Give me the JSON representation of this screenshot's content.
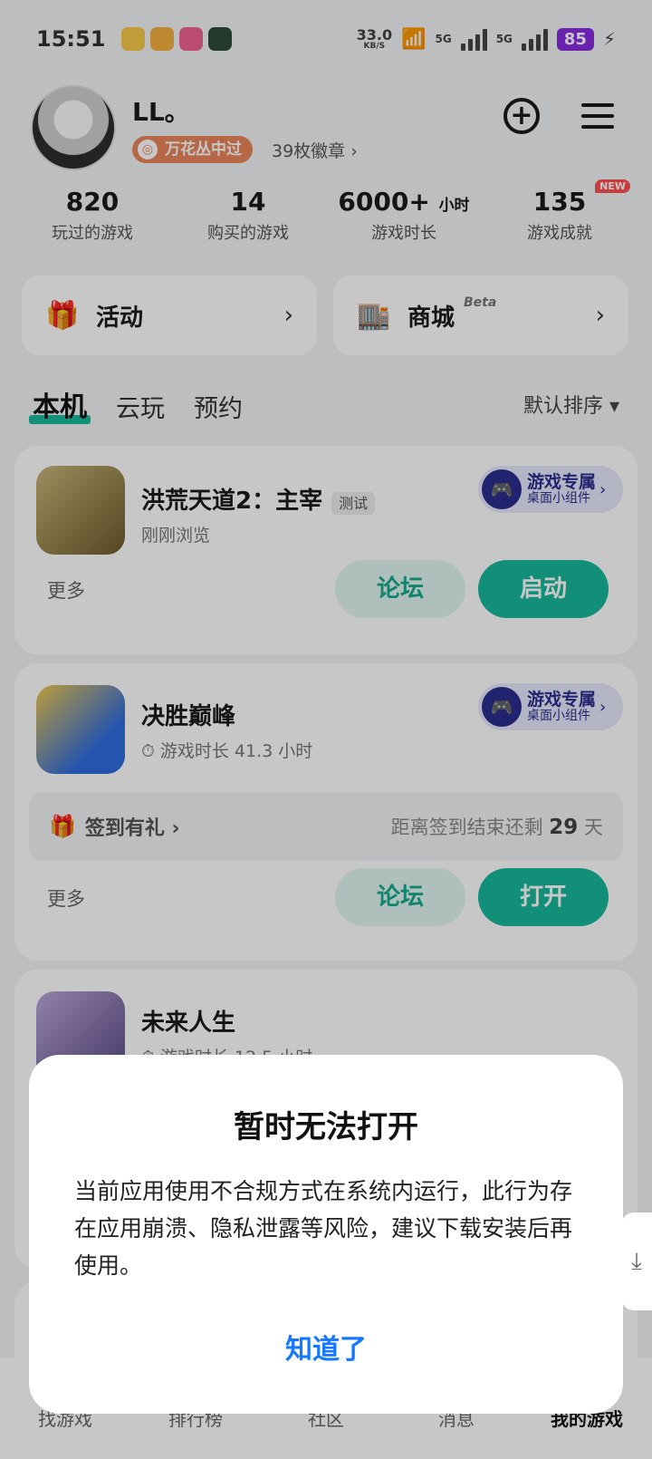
{
  "status_bar": {
    "time": "15:51",
    "net_speed": "33.0",
    "net_unit": "KB/S",
    "net_type_1": "5G",
    "net_type_2": "5G",
    "battery": "85"
  },
  "profile": {
    "username": "LL。",
    "badge_label": "万花丛中过",
    "badge_count": "39枚徽章 ›"
  },
  "stats": [
    {
      "value": "820",
      "unit": "",
      "label": "玩过的游戏"
    },
    {
      "value": "14",
      "unit": "",
      "label": "购买的游戏"
    },
    {
      "value": "6000+",
      "unit": "小时",
      "label": "游戏时长"
    },
    {
      "value": "135",
      "unit": "",
      "label": "游戏成就",
      "badge": "NEW"
    }
  ],
  "quick": {
    "activity": "活动",
    "mall": "商城",
    "mall_tag": "Beta"
  },
  "tabs": [
    "本机",
    "云玩",
    "预约"
  ],
  "sort_label": "默认排序 ▾",
  "widget": {
    "title": "游戏专属",
    "sub": "桌面小组件"
  },
  "games": [
    {
      "name": "洪荒天道2：主宰",
      "tag": "测试",
      "sub": "刚刚浏览",
      "more": "更多",
      "forum": "论坛",
      "action": "启动"
    },
    {
      "name": "决胜巅峰",
      "sub": "游戏时长 41.3 小时",
      "checkin_label": "签到有礼 ›",
      "checkin_prefix": "距离签到结束还剩",
      "checkin_days": "29",
      "checkin_suffix": "天",
      "more": "更多",
      "forum": "论坛",
      "action": "打开"
    },
    {
      "name": "未来人生",
      "sub": "游戏时长 12.5 小时"
    }
  ],
  "bottom_nav": [
    "找游戏",
    "排行榜",
    "社区",
    "消息",
    "我的游戏"
  ],
  "dialog": {
    "title": "暂时无法打开",
    "body": "当前应用使用不合规方式在系统内运行，此行为存在应用崩溃、隐私泄露等风险，建议下载安装后再使用。",
    "button": "知道了"
  }
}
